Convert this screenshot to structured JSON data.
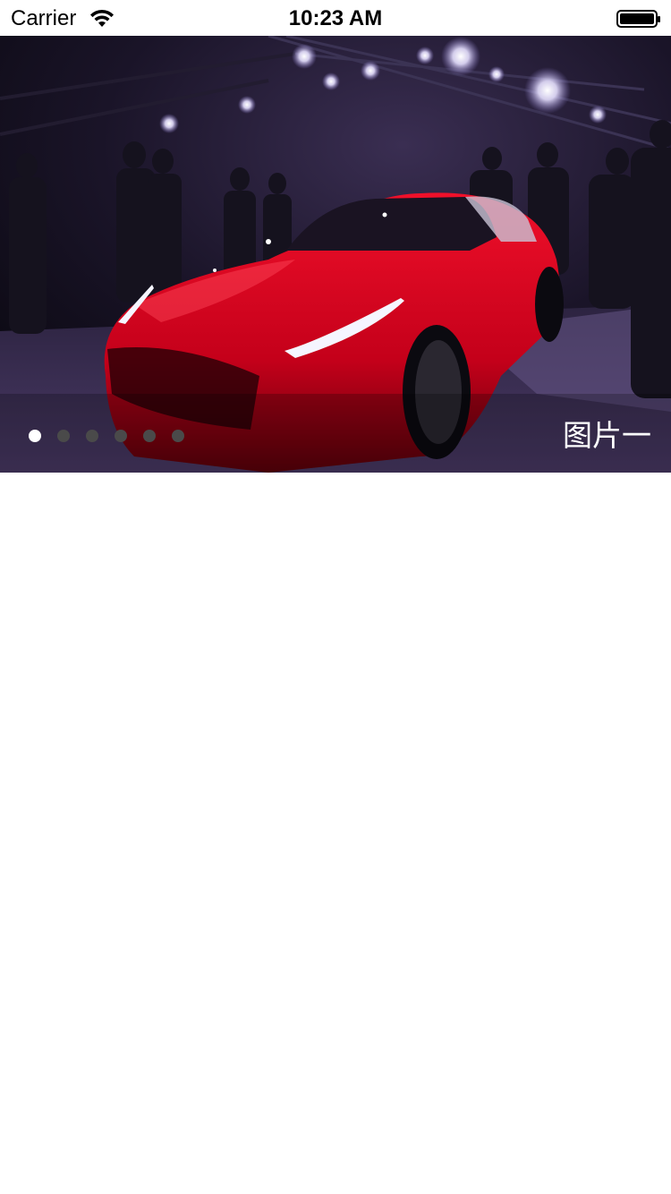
{
  "status_bar": {
    "carrier": "Carrier",
    "time": "10:23 AM",
    "icons": [
      "wifi-icon",
      "battery-icon"
    ]
  },
  "carousel": {
    "caption": "图片一",
    "page_count": 6,
    "current_page": 1,
    "image_subject": "red sports car at indoor event",
    "colors": {
      "active_dot": "#ffffff",
      "inactive_dot": "#4a4a4a",
      "car_red": "#d4001a"
    }
  }
}
